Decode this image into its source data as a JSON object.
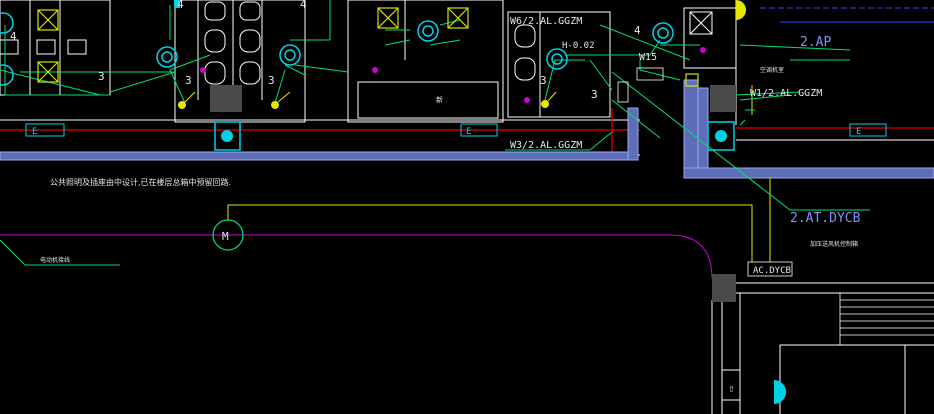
{
  "colors": {
    "background": "#000000",
    "wall": "#ffffff",
    "fixture": "#00d2e6",
    "circuit": "#00e070",
    "conduit_yellow": "#e6e600",
    "pipe_magenta": "#d000d0",
    "duct_blue": "#8090d8",
    "red_line": "#e00000",
    "label_white": "#e6e6e6"
  },
  "labels": {
    "circuit_w6": "W6/2.AL.GGZM",
    "circuit_h": "H-0.02",
    "circuit_w15": "W15",
    "circuit_w1": "W1/2.AL.GGZM",
    "circuit_w3": "W3/2.AL.GGZM",
    "panel_2ap": "2.AP",
    "panel_2atdycb": "2.AT.DYCB",
    "panel_acdycb": "AC.DYCB",
    "motor": "M",
    "num_4a": "4",
    "num_4b": "4",
    "num_4c": "4",
    "num_4d": "4",
    "num_3a": "3",
    "num_3b": "3",
    "num_3c": "3",
    "num_3d": "3",
    "num_3e": "3",
    "note_public_area": "公共照明及插座由中设计,已在楼层总箱中预留回路.",
    "note_motor": "电动机接线",
    "note_room": "新",
    "note_right_small": "空调机室",
    "note_dycb": "加压送风机控制箱",
    "duct_tag_left": "E",
    "duct_tag_mid": "E",
    "duct_tag_right": "E",
    "stair_arrow": "⇧"
  }
}
